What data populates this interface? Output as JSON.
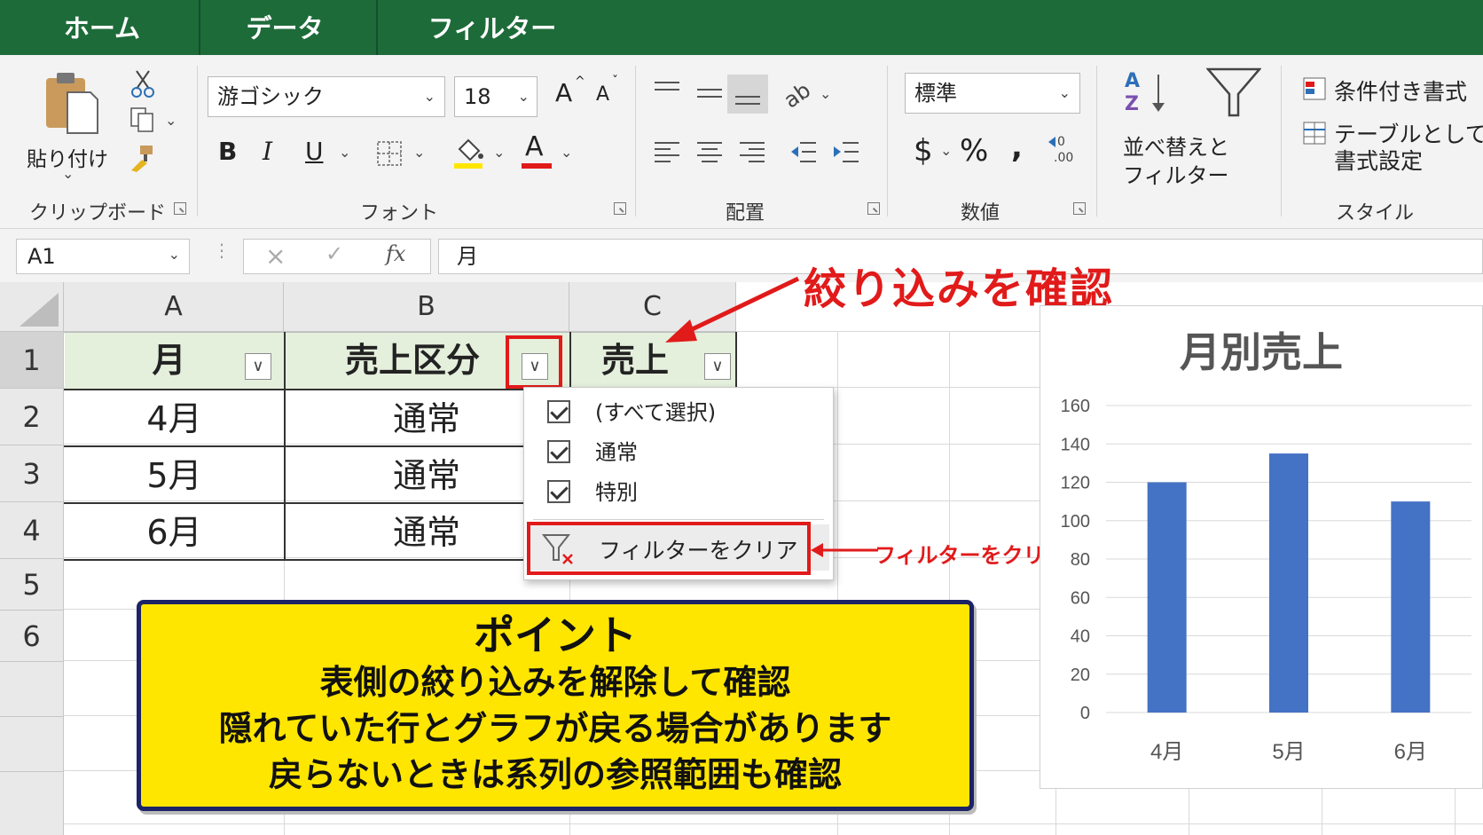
{
  "tabs": [
    {
      "label": "ホーム"
    },
    {
      "label": "データ"
    },
    {
      "label": "フィルター"
    }
  ],
  "ribbon": {
    "clipboard": {
      "paste_label": "貼り付け",
      "group_label": "クリップボード"
    },
    "font": {
      "font_name": "游ゴシック",
      "font_size": "18",
      "bold": "B",
      "italic": "I",
      "underline": "U",
      "grow": "A",
      "shrink": "A",
      "color_a": "A",
      "group_label": "フォント"
    },
    "alignment": {
      "group_label": "配置"
    },
    "number": {
      "format": "標準",
      "currency": "$",
      "percent": "%",
      "comma": ",",
      "group_label": "数値"
    },
    "sort_filter": {
      "line1": "並べ替えと",
      "line2": "フィルター"
    },
    "styles": {
      "conditional": "条件付き書式",
      "table_line1": "テーブルとして",
      "table_line2": "書式設定",
      "group_label": "スタイル"
    },
    "colors": {
      "highlight": "#ffe600",
      "font_color": "#e11a1a"
    }
  },
  "formula_bar": {
    "name_box": "A1",
    "cancel": "×",
    "enter": "✓",
    "fx": "fx",
    "formula": "月"
  },
  "sheet": {
    "columns": [
      "A",
      "B",
      "C"
    ],
    "rows": [
      "1",
      "2",
      "3",
      "4",
      "5",
      "6"
    ],
    "header": [
      "月",
      "売上区分",
      "売上"
    ],
    "data": [
      [
        "4月",
        "通常"
      ],
      [
        "5月",
        "通常"
      ],
      [
        "6月",
        "通常"
      ]
    ],
    "header_fill": "#e4efdc"
  },
  "dropdown": {
    "items": [
      {
        "label": "(すべて選択)",
        "checked": true
      },
      {
        "label": "通常",
        "checked": true
      },
      {
        "label": "特別",
        "checked": true
      }
    ],
    "clear_label": "フィルターをクリア"
  },
  "annotations": {
    "confirm_filter": "絞り込みを確認",
    "clear_filter": "フィルターをクリア",
    "accent_color": "#e11a1a"
  },
  "point_box": {
    "title": "ポイント",
    "lines": [
      "表側の絞り込みを解除して確認",
      "隠れていた行とグラフが戻る場合があります",
      "戻らないときは系列の参照範囲も確認"
    ]
  },
  "chart_data": {
    "type": "bar",
    "title": "月別売上",
    "categories": [
      "4月",
      "5月",
      "6月"
    ],
    "values": [
      120,
      135,
      110
    ],
    "ylim": [
      0,
      160
    ],
    "yticks": [
      "0",
      "20",
      "40",
      "60",
      "80",
      "100",
      "120",
      "140",
      "160"
    ],
    "grid": true,
    "bar_color": "#4472c4"
  }
}
